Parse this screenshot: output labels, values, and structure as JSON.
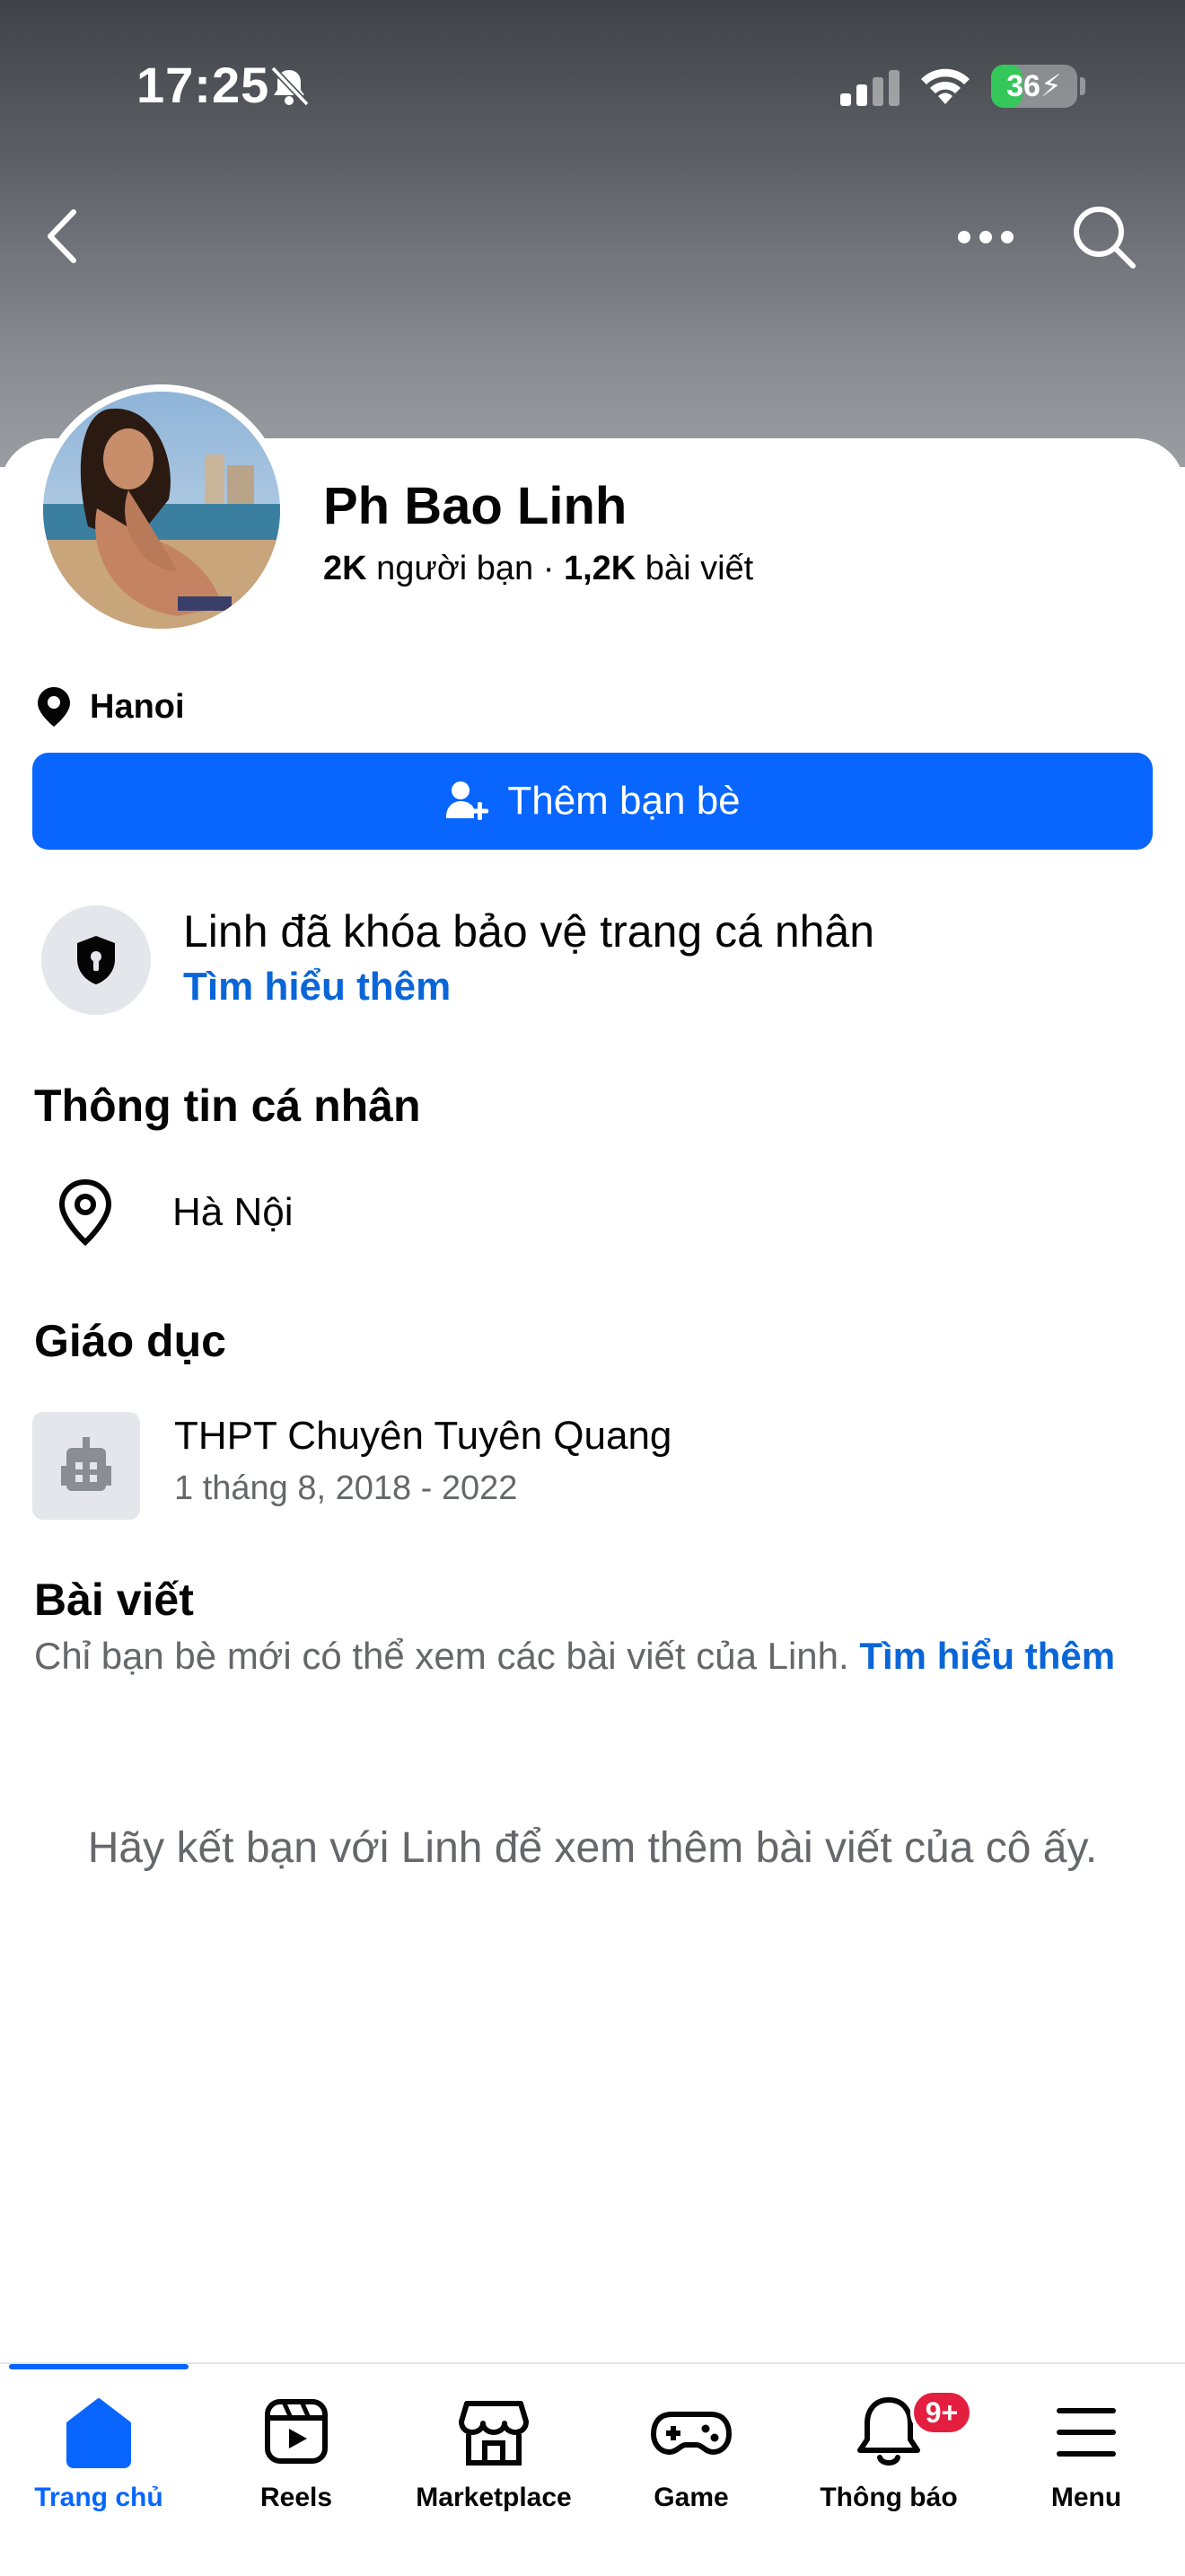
{
  "status_bar": {
    "time": "17:25",
    "battery": "36",
    "battery_level": 0.36
  },
  "profile": {
    "name": "Ph Bao Linh",
    "friends_count": "2K",
    "friends_label": "người bạn",
    "separator": "·",
    "posts_count": "1,2K",
    "posts_label": "bài viết",
    "location": "Hanoi"
  },
  "actions": {
    "add_friend": "Thêm bạn bè"
  },
  "lock_notice": {
    "title": "Linh đã khóa bảo vệ trang cá nhân",
    "link": "Tìm hiểu thêm"
  },
  "personal_info": {
    "title": "Thông tin cá nhân",
    "city": "Hà Nội"
  },
  "education": {
    "title": "Giáo dục",
    "school": "THPT Chuyên Tuyên Quang",
    "period": "1 tháng 8, 2018 - 2022"
  },
  "posts": {
    "title": "Bài viết",
    "note": "Chỉ bạn bè mới có thể xem các bài viết của Linh.",
    "note_link": "Tìm hiểu thêm",
    "empty_message": "Hãy kết bạn với Linh để xem thêm bài viết của cô ấy."
  },
  "tabbar": {
    "home": "Trang chủ",
    "reels": "Reels",
    "marketplace": "Marketplace",
    "game": "Game",
    "notifications": "Thông báo",
    "notifications_badge": "9+",
    "menu": "Menu"
  },
  "colors": {
    "primary": "#0866ff",
    "link": "#0a66d8",
    "badge": "#e41e3f",
    "battery": "#34c759"
  }
}
